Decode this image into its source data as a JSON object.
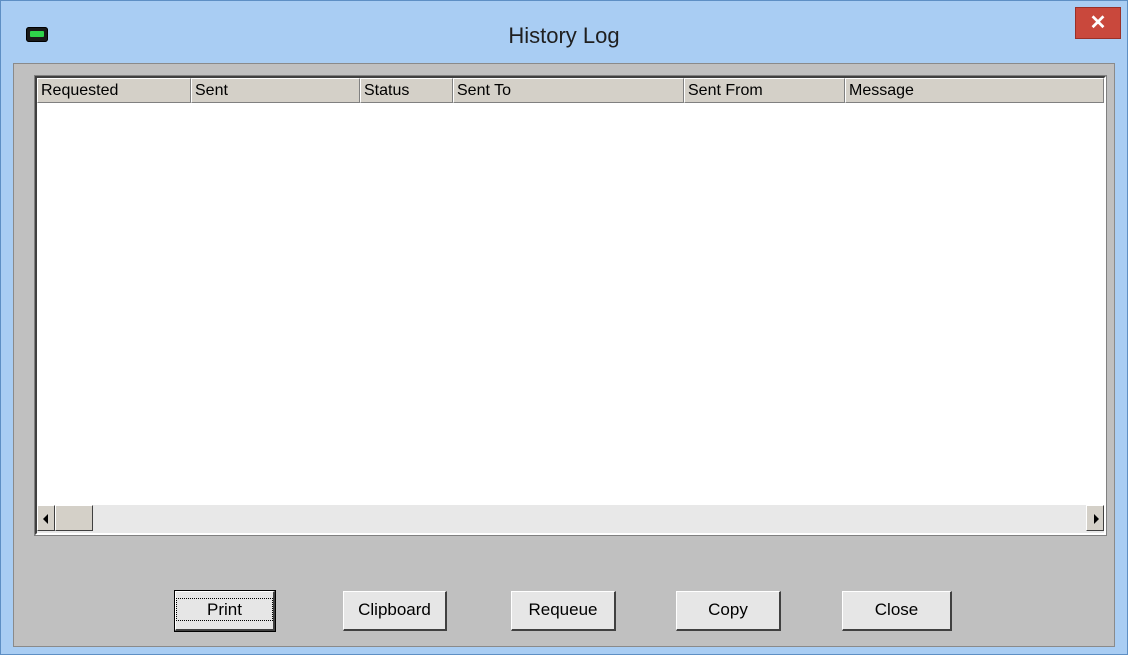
{
  "window": {
    "title": "History Log",
    "close_glyph": "✕",
    "app_icon": "pager-icon"
  },
  "list": {
    "columns": [
      "Requested",
      "Sent",
      "Status",
      "Sent To",
      "Sent From",
      "Message"
    ],
    "rows": []
  },
  "scrollbar": {
    "left_arrow_icon": "arrow-left-icon",
    "right_arrow_icon": "arrow-right-icon"
  },
  "buttons": {
    "print": "Print",
    "clipboard": "Clipboard",
    "requeue": "Requeue",
    "copy": "Copy",
    "close": "Close"
  }
}
